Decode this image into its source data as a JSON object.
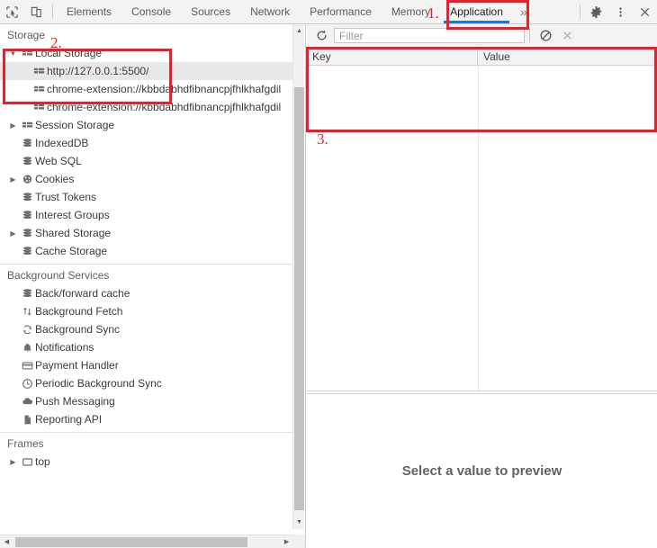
{
  "toolbar": {
    "inspect_icon": "inspect-cursor-icon",
    "device_icon": "device-toolbar-icon",
    "tabs": [
      {
        "label": "Elements",
        "active": false
      },
      {
        "label": "Console",
        "active": false
      },
      {
        "label": "Sources",
        "active": false
      },
      {
        "label": "Network",
        "active": false
      },
      {
        "label": "Performance",
        "active": false
      },
      {
        "label": "Memory",
        "active": false
      },
      {
        "label": "Application",
        "active": true
      }
    ],
    "more_tabs_label": "»",
    "settings_icon": "gear-icon",
    "menu_icon": "kebab-menu-icon",
    "close_icon": "close-icon"
  },
  "sidebar": {
    "storage_section": "Storage",
    "storage_items": [
      {
        "label": "Local Storage",
        "icon": "storage-table-icon",
        "twisty": "expanded",
        "depth": 1,
        "selected": false
      },
      {
        "label": "http://127.0.0.1:5500/",
        "icon": "storage-table-icon",
        "twisty": "none",
        "depth": 2,
        "selected": true
      },
      {
        "label": "chrome-extension://kbbdabhdfibnancpjfhlkhafgdil",
        "icon": "storage-table-icon",
        "twisty": "none",
        "depth": 2,
        "selected": false
      },
      {
        "label": "chrome-extension://kbbdabhdfibnancpjfhlkhafgdil",
        "icon": "storage-table-icon",
        "twisty": "none",
        "depth": 2,
        "selected": false
      },
      {
        "label": "Session Storage",
        "icon": "storage-table-icon",
        "twisty": "collapsed",
        "depth": 1,
        "selected": false
      },
      {
        "label": "IndexedDB",
        "icon": "database-icon",
        "twisty": "none",
        "depth": 1,
        "selected": false
      },
      {
        "label": "Web SQL",
        "icon": "database-icon",
        "twisty": "none",
        "depth": 1,
        "selected": false
      },
      {
        "label": "Cookies",
        "icon": "cookie-icon",
        "twisty": "collapsed",
        "depth": 1,
        "selected": false
      },
      {
        "label": "Trust Tokens",
        "icon": "database-icon",
        "twisty": "none",
        "depth": 1,
        "selected": false
      },
      {
        "label": "Interest Groups",
        "icon": "database-icon",
        "twisty": "none",
        "depth": 1,
        "selected": false
      },
      {
        "label": "Shared Storage",
        "icon": "database-icon",
        "twisty": "collapsed",
        "depth": 1,
        "selected": false
      },
      {
        "label": "Cache Storage",
        "icon": "database-icon",
        "twisty": "none",
        "depth": 1,
        "selected": false
      }
    ],
    "background_section": "Background Services",
    "background_items": [
      {
        "label": "Back/forward cache",
        "icon": "database-icon"
      },
      {
        "label": "Background Fetch",
        "icon": "updown-arrows-icon"
      },
      {
        "label": "Background Sync",
        "icon": "sync-refresh-icon"
      },
      {
        "label": "Notifications",
        "icon": "bell-icon"
      },
      {
        "label": "Payment Handler",
        "icon": "credit-card-icon"
      },
      {
        "label": "Periodic Background Sync",
        "icon": "clock-icon"
      },
      {
        "label": "Push Messaging",
        "icon": "cloud-icon"
      },
      {
        "label": "Reporting API",
        "icon": "document-icon"
      }
    ],
    "frames_section": "Frames",
    "frames_items": [
      {
        "label": "top",
        "icon": "frame-window-icon",
        "twisty": "collapsed"
      }
    ]
  },
  "rightpane": {
    "refresh_icon": "refresh-icon",
    "filter_placeholder": "Filter",
    "clear_icon": "no-entry-clear-icon",
    "delete_icon": "delete-x-icon",
    "columns": [
      "Key",
      "Value"
    ],
    "rows": [],
    "preview_message": "Select a value to preview"
  },
  "annotations": [
    {
      "number": "1.",
      "target": "application-tab"
    },
    {
      "number": "2.",
      "target": "local-storage-origin"
    },
    {
      "number": "3.",
      "target": "key-value-table"
    }
  ],
  "colors": {
    "accent": "#1a73e8",
    "annotation": "#e8202a",
    "toolbar_bg": "#f3f3f3",
    "selection_bg": "#e8e8e8"
  }
}
